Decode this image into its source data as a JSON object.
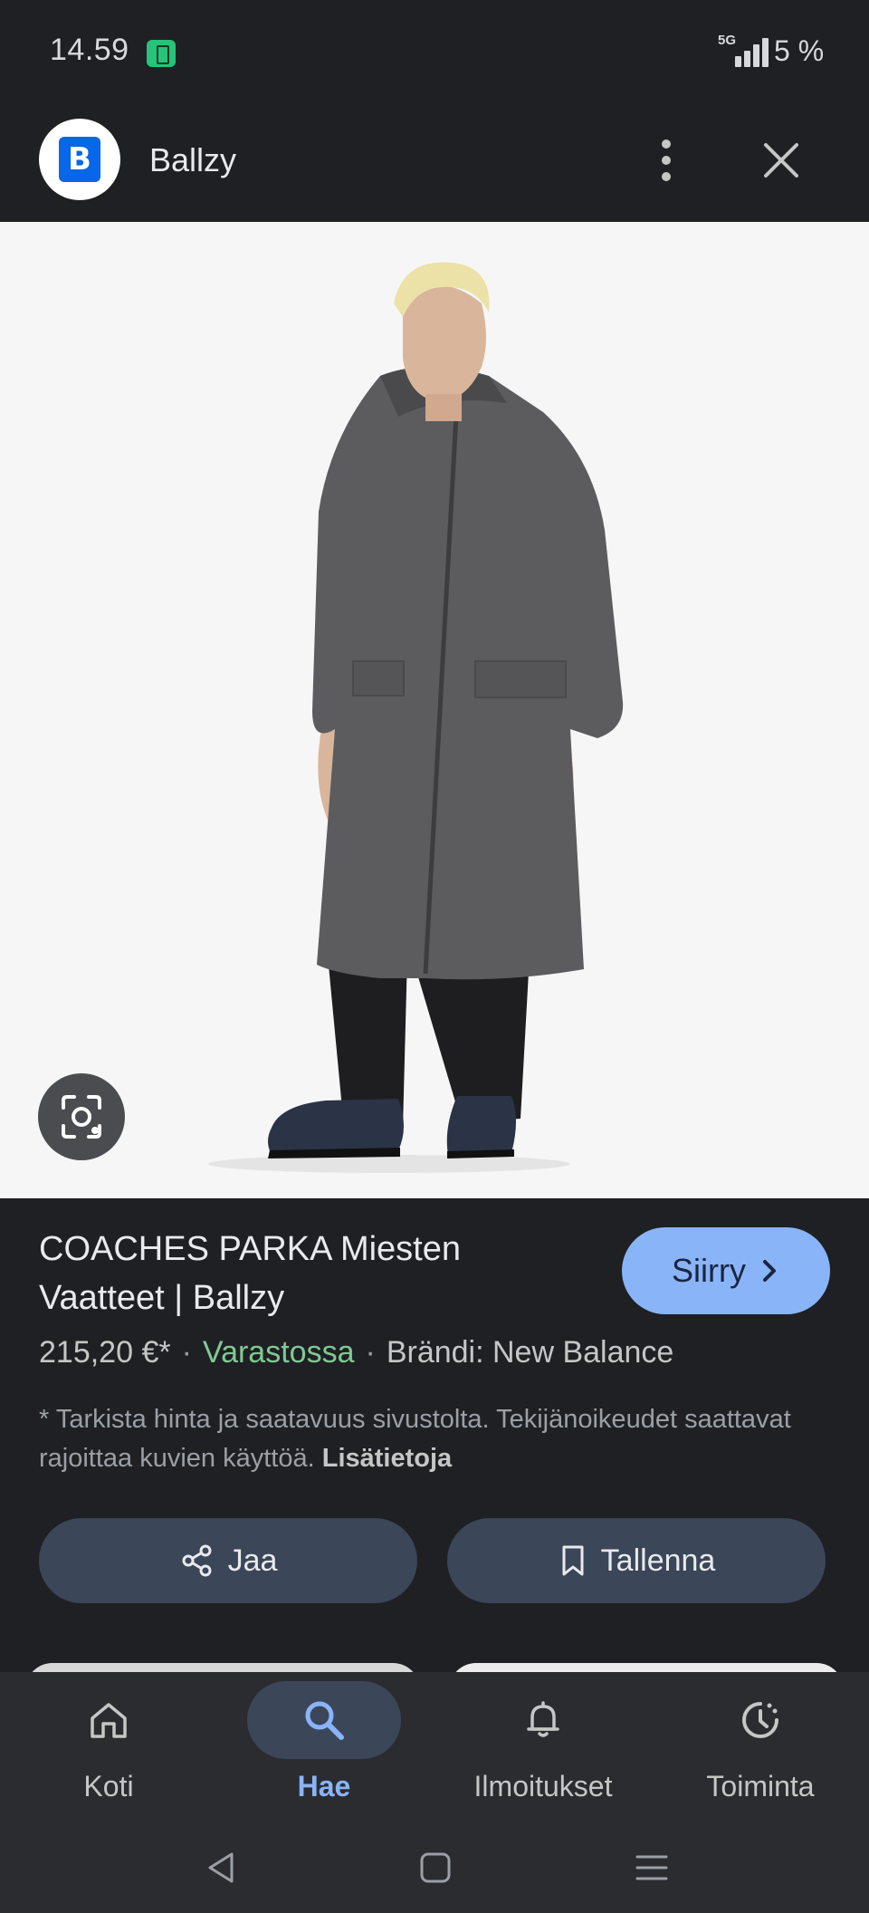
{
  "status_bar": {
    "time": "14.59",
    "network": "5G",
    "battery": "5 %"
  },
  "header": {
    "site_logo_letter": "B",
    "site_name": "Ballzy"
  },
  "product": {
    "title": "COACHES PARKA Miesten Vaatteet | Ballzy",
    "price": "215,20 €*",
    "separator": "·",
    "availability": "Varastossa",
    "brand": "Brändi: New Balance",
    "disclaimer": "* Tarkista hinta ja saatavuus sivustolta. Tekijänoikeudet saattavat rajoittaa kuvien käyttöä.",
    "more_info_link": "Lisätietoja"
  },
  "actions": {
    "visit_label": "Siirry",
    "share_label": "Jaa",
    "save_label": "Tallenna"
  },
  "bottom_nav": {
    "items": [
      {
        "label": "Koti",
        "icon": "home-icon"
      },
      {
        "label": "Hae",
        "icon": "search-icon",
        "active": true
      },
      {
        "label": "Ilmoitukset",
        "icon": "bell-icon"
      },
      {
        "label": "Toiminta",
        "icon": "activity-icon"
      }
    ]
  },
  "colors": {
    "background": "#1f2023",
    "accent": "#8ab4f8",
    "in_stock": "#81c995",
    "button_bg": "#3b4658"
  }
}
